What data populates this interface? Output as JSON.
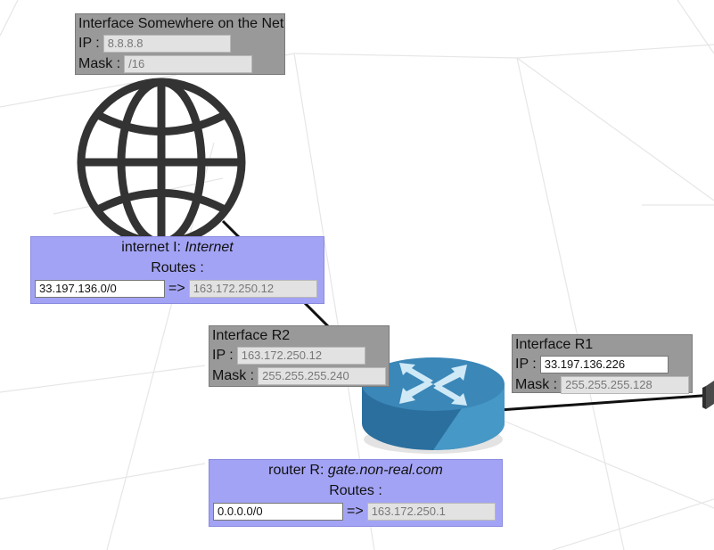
{
  "interface_net": {
    "title": "Interface Somewhere on the Net",
    "ip_label": "IP :",
    "ip": "8.8.8.8",
    "mask_label": "Mask :",
    "mask": "/16"
  },
  "internet": {
    "title_prefix": "internet I: ",
    "title_name": "Internet",
    "routes_label": "Routes :",
    "route": {
      "destination": "33.197.136.0/0",
      "arrow": "=>",
      "gateway": "163.172.250.12"
    }
  },
  "interface_r2": {
    "title": "Interface R2",
    "ip_label": "IP :",
    "ip": "163.172.250.12",
    "mask_label": "Mask :",
    "mask": "255.255.255.240"
  },
  "interface_r1": {
    "title": "Interface R1",
    "ip_label": "IP :",
    "ip": "33.197.136.226",
    "mask_label": "Mask :",
    "mask": "255.255.255.128"
  },
  "router": {
    "title_prefix": "router R: ",
    "title_name": "gate.non-real.com",
    "routes_label": "Routes :",
    "route": {
      "destination": "0.0.0.0/0",
      "arrow": "=>",
      "gateway": "163.172.250.1"
    }
  },
  "icons": [
    "globe-icon",
    "router-icon",
    "switch-icon"
  ],
  "colors": {
    "interface_box": "#999999",
    "node_box": "#a3a3f5",
    "router_body": "#2f7eb0",
    "link": "#111111"
  }
}
